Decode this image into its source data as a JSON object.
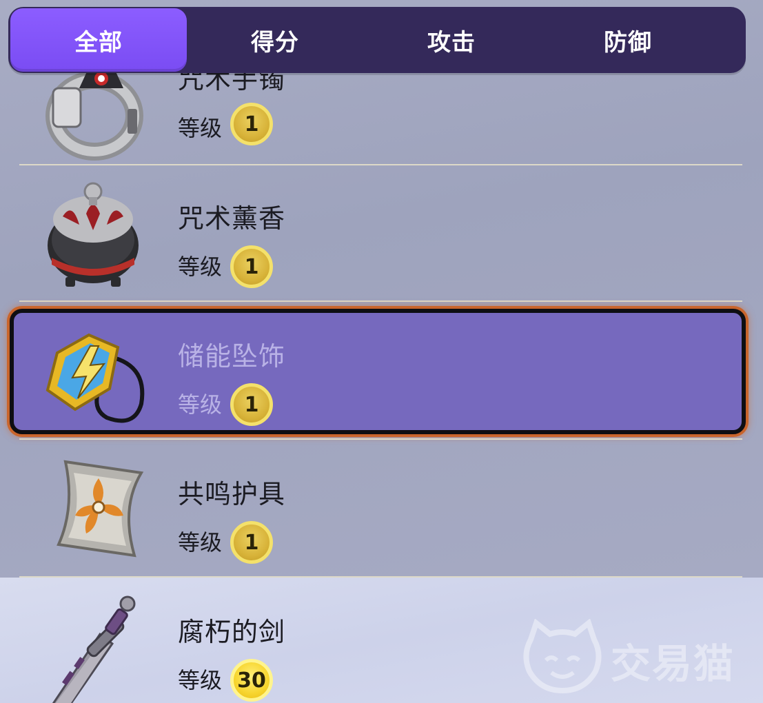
{
  "tabs": [
    {
      "label": "全部",
      "active": true
    },
    {
      "label": "得分",
      "active": false
    },
    {
      "label": "攻击",
      "active": false
    },
    {
      "label": "防御",
      "active": false
    }
  ],
  "level_label": "等级",
  "items": [
    {
      "name": "咒术手镯",
      "level": "1",
      "icon": "bracelet-icon"
    },
    {
      "name": "咒术薰香",
      "level": "1",
      "icon": "incense-pot-icon"
    },
    {
      "name": "储能坠饰",
      "level": "1",
      "icon": "energy-pendant-icon",
      "selected": true
    },
    {
      "name": "共鸣护具",
      "level": "1",
      "icon": "resonance-guard-icon"
    },
    {
      "name": "腐朽的剑",
      "level": "30",
      "icon": "rusted-sword-icon"
    }
  ],
  "watermark": {
    "text": "交易猫",
    "icon": "cat-logo-icon"
  },
  "colors": {
    "tabbar_bg": "#34295a",
    "tab_active": "#7a4cf3",
    "selected_row": "#7669be",
    "selected_glow": "#c9652c",
    "level_badge": "#d8b339"
  }
}
